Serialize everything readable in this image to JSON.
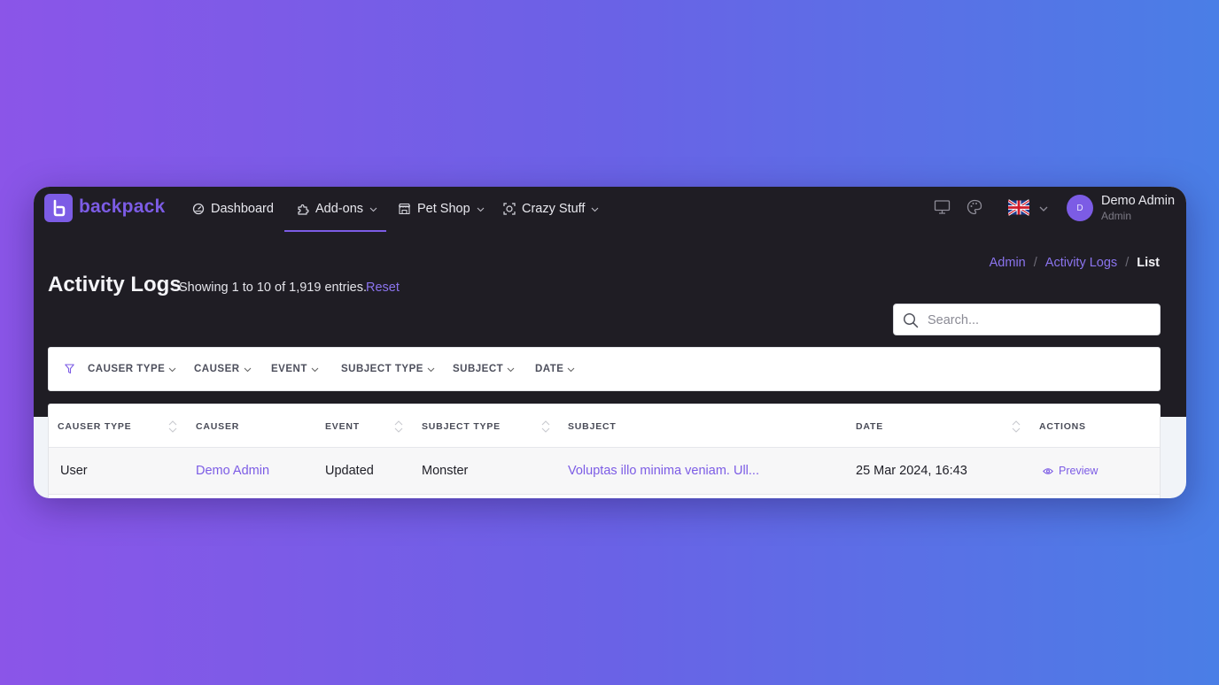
{
  "brand": {
    "name": "backpack",
    "accent": "#7c5ce5"
  },
  "nav": {
    "dashboard": "Dashboard",
    "addons": "Add-ons",
    "petshop": "Pet Shop",
    "crazy": "Crazy Stuff"
  },
  "user": {
    "initial": "D",
    "name": "Demo Admin",
    "role": "Admin"
  },
  "breadcrumb": {
    "items": [
      "Admin",
      "Activity Logs"
    ],
    "current": "List",
    "separator": "/"
  },
  "page": {
    "title": "Activity Logs",
    "entries_text": "Showing 1 to 10 of 1,919 entries.",
    "reset_label": "Reset"
  },
  "search": {
    "placeholder": "Search..."
  },
  "filters": [
    "CAUSER TYPE",
    "CAUSER",
    "EVENT",
    "SUBJECT TYPE",
    "SUBJECT",
    "DATE"
  ],
  "table": {
    "columns": [
      "CAUSER TYPE",
      "CAUSER",
      "EVENT",
      "SUBJECT TYPE",
      "SUBJECT",
      "DATE",
      "ACTIONS"
    ],
    "rows": [
      {
        "causer_type": "User",
        "causer": "Demo Admin",
        "event": "Updated",
        "subject_type": "Monster",
        "subject": "Voluptas illo minima veniam. Ull...",
        "date": "25 Mar 2024, 16:43",
        "action": "Preview"
      }
    ]
  }
}
